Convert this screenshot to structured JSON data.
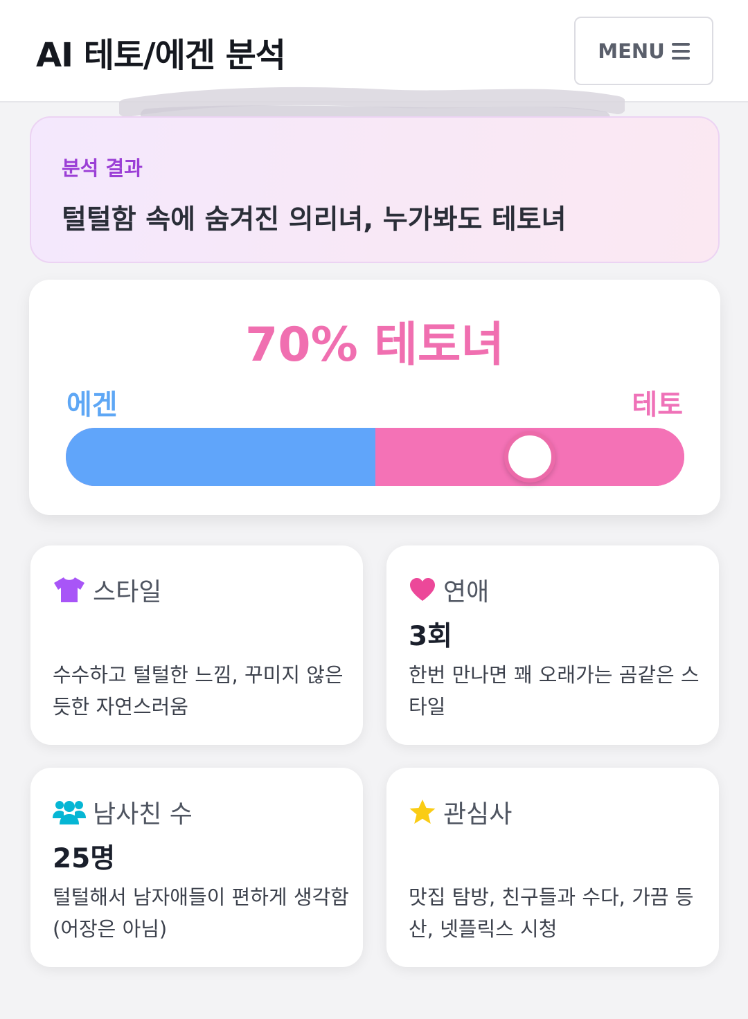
{
  "header": {
    "title": "AI 테토/에겐 분석",
    "menu_label": "MENU"
  },
  "result": {
    "label": "분석 결과",
    "text": "털털함 속에 숨겨진 의리녀, 누가봐도 테토녀"
  },
  "score": {
    "title": "70% 테토녀",
    "left_label": "에겐",
    "right_label": "테토",
    "teto_percent": 70,
    "colors": {
      "egen": "#60a5fa",
      "teto": "#f472b6"
    }
  },
  "cards": [
    {
      "icon": "shirt-icon",
      "title": "스타일",
      "value": "",
      "desc": "수수하고 털털한 느낌, 꾸미지 않은듯한 자연스러움",
      "icon_color": "#a855f7"
    },
    {
      "icon": "heart-icon",
      "title": "연애",
      "value": "3회",
      "desc": "한번 만나면 꽤 오래가는 곰같은 스타일",
      "icon_color": "#ec4899"
    },
    {
      "icon": "users-icon",
      "title": "남사친 수",
      "value": "25명",
      "desc": "털털해서 남자애들이 편하게 생각함 (어장은 아님)",
      "icon_color": "#06b6d4"
    },
    {
      "icon": "star-icon",
      "title": "관심사",
      "value": "",
      "desc": "맛집 탐방, 친구들과 수다, 가끔 등산, 넷플릭스 시청",
      "icon_color": "#facc15"
    }
  ]
}
